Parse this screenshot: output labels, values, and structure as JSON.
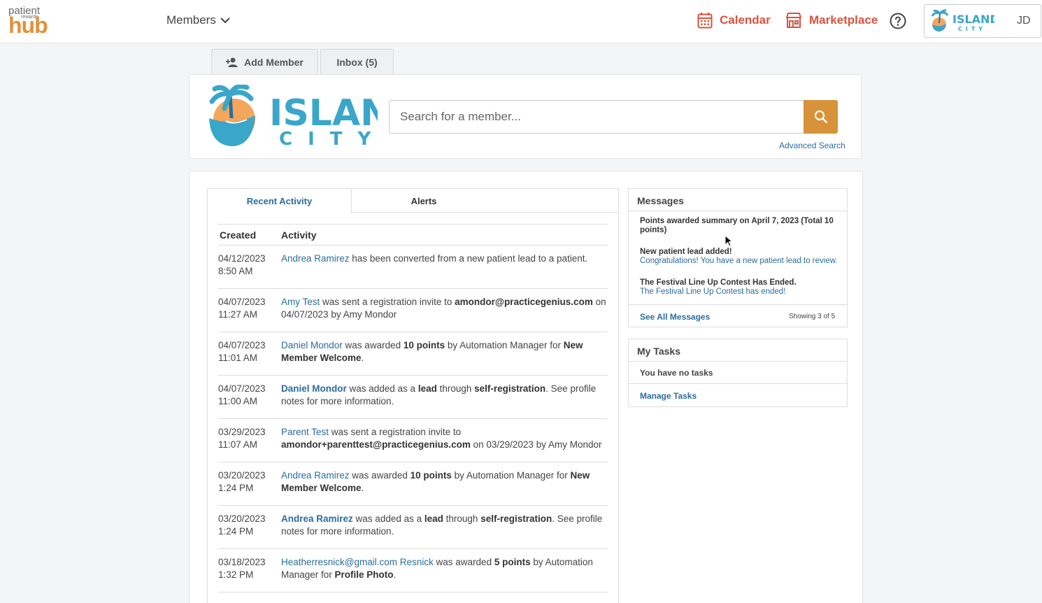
{
  "brand": {
    "logo_line1": "patient",
    "logo_line2": "rewards",
    "logo_line3": "hub",
    "accent": "#e2913b",
    "link_color": "#2a6d9e",
    "nav_color": "#d9533f"
  },
  "nav": {
    "members_label": "Members",
    "calendar_label": "Calendar",
    "marketplace_label": "Marketplace",
    "user_initials": "JD"
  },
  "practice_logo": {
    "line1": "ISLAND",
    "line2": "CITY"
  },
  "top_tabs": {
    "add_member": "Add Member",
    "inbox": "Inbox (5)"
  },
  "search": {
    "placeholder": "Search for a member...",
    "advanced": "Advanced Search"
  },
  "activity": {
    "tabs": [
      "Recent Activity",
      "Alerts"
    ],
    "headers": [
      "Created",
      "Activity"
    ],
    "rows": [
      {
        "date": "04/12/2023",
        "time": "8:50 AM",
        "name": "Andrea Ramirez",
        "text": " has been converted from a new patient lead to a patient."
      },
      {
        "date": "04/07/2023",
        "time": "11:27 AM",
        "name": "Amy Test",
        "t1": " was sent a registration invite to ",
        "b1": "amondor@practicegenius.com",
        "t2": " on 04/07/2023 by Amy Mondor"
      },
      {
        "date": "04/07/2023",
        "time": "11:01 AM",
        "name": "Daniel Mondor",
        "t1": " was awarded ",
        "b1": "10 points",
        "t2": " by Automation Manager for ",
        "b2": "New Member Welcome",
        "t3": "."
      },
      {
        "date": "04/07/2023",
        "time": "11:00 AM",
        "name": "Daniel Mondor",
        "t1": " was added as a ",
        "b1": "lead",
        "t2": " through ",
        "b2": "self-registration",
        "t3": ". See profile notes for more information."
      },
      {
        "date": "03/29/2023",
        "time": "11:07 AM",
        "name": "Parent Test",
        "t1": " was sent a registration invite to ",
        "b1": "amondor+parenttest@practicegenius.com",
        "t2": " on 03/29/2023 by Amy Mondor"
      },
      {
        "date": "03/20/2023",
        "time": "1:24 PM",
        "name": "Andrea Ramirez",
        "t1": " was awarded ",
        "b1": "10 points",
        "t2": " by Automation Manager for ",
        "b2": "New Member Welcome",
        "t3": "."
      },
      {
        "date": "03/20/2023",
        "time": "1:24 PM",
        "name": "Andrea Ramirez",
        "t1": " was added as a ",
        "b1": "lead",
        "t2": " through ",
        "b2": "self-registration",
        "t3": ". See profile notes for more information."
      },
      {
        "date": "03/18/2023",
        "time": "1:32 PM",
        "name": "Heatherresnick@gmail.com Resnick",
        "t1": " was awarded ",
        "b1": "5 points",
        "t2": " by Automation Manager for ",
        "b2": "Profile Photo",
        "t3": "."
      }
    ]
  },
  "messages": {
    "title": "Messages",
    "items": [
      {
        "title": "Points awarded summary on April 7, 2023 (Total 10 points)",
        "body": ""
      },
      {
        "title": "New patient lead added!",
        "body": "Congratulations! You have a new patient lead to review."
      },
      {
        "title": "The Festival Line Up Contest Has Ended.",
        "body": "The Festival Line Up Contest has ended!"
      }
    ],
    "see_all": "See All Messages",
    "showing": "Showing 3 of 5"
  },
  "tasks": {
    "title": "My Tasks",
    "empty": "You have no tasks",
    "manage": "Manage Tasks"
  }
}
